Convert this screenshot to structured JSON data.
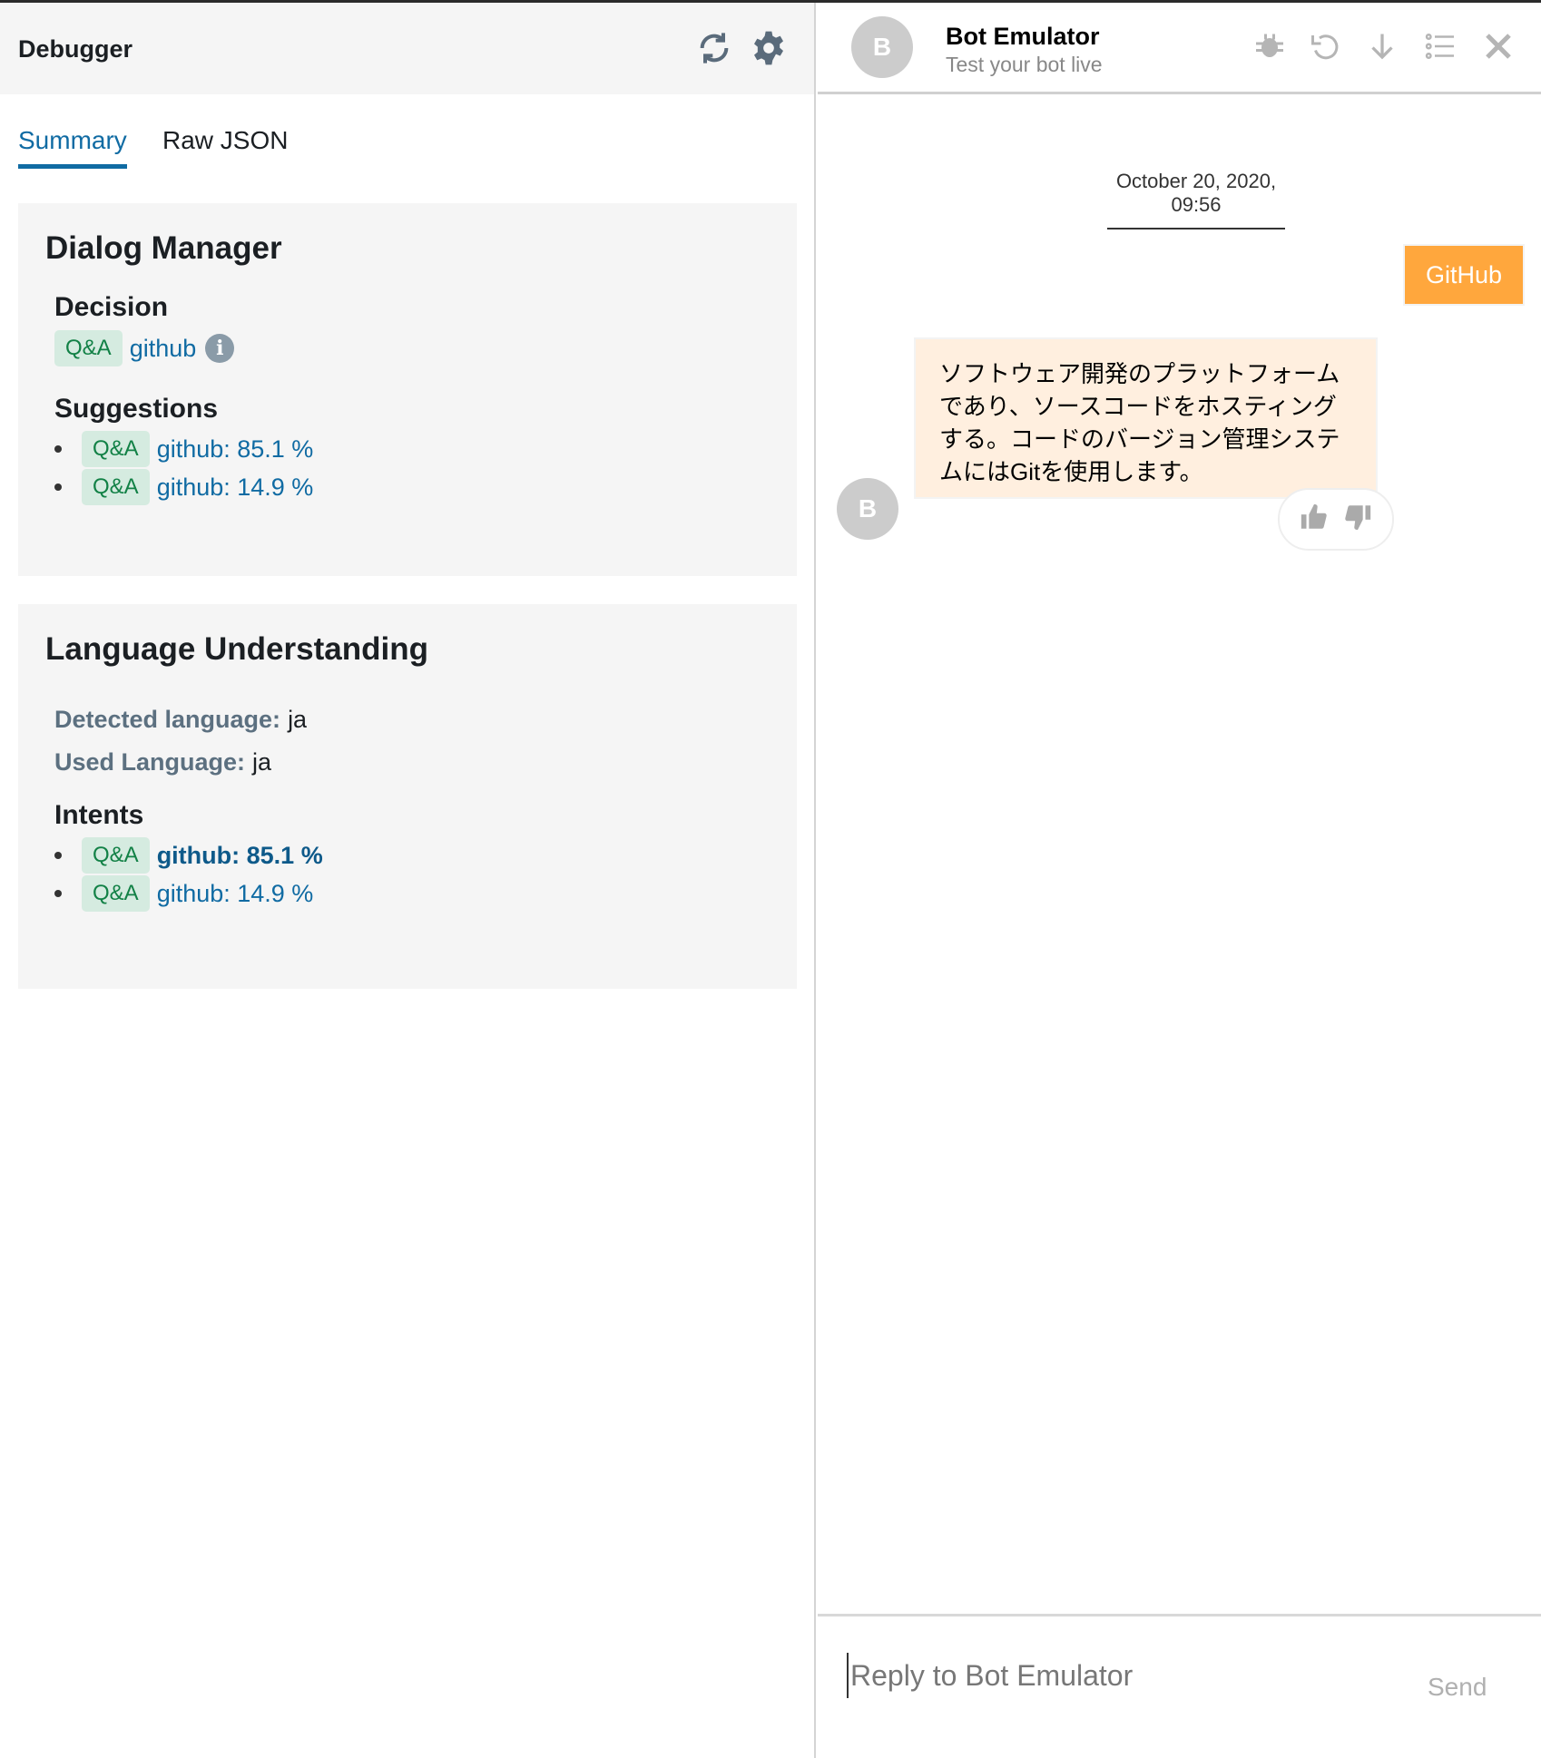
{
  "debugger": {
    "title": "Debugger",
    "icons": [
      "refresh-icon",
      "gear-icon"
    ],
    "tabs": [
      {
        "label": "Summary",
        "active": true
      },
      {
        "label": "Raw JSON",
        "active": false
      }
    ],
    "dialog_manager": {
      "title": "Dialog Manager",
      "decision_label": "Decision",
      "decision": {
        "badge": "Q&A",
        "value": "github"
      },
      "suggestions_label": "Suggestions",
      "suggestions": [
        {
          "badge": "Q&A",
          "value": "github: 85.1 %"
        },
        {
          "badge": "Q&A",
          "value": "github: 14.9 %"
        }
      ]
    },
    "language_understanding": {
      "title": "Language Understanding",
      "detected_label": "Detected language:",
      "detected_value": "ja",
      "used_label": "Used Language:",
      "used_value": "ja",
      "intents_label": "Intents",
      "intents": [
        {
          "badge": "Q&A",
          "value": "github: 85.1 %",
          "bold": true
        },
        {
          "badge": "Q&A",
          "value": "github: 14.9 %",
          "bold": false
        }
      ]
    }
  },
  "emulator": {
    "avatar_letter": "B",
    "title": "Bot Emulator",
    "subtitle": "Test your bot live",
    "icons": [
      "bug-icon",
      "undo-icon",
      "download-icon",
      "list-icon",
      "close-icon"
    ],
    "date": "October 20, 2020, 09:56",
    "user_message": "GitHub",
    "bot_message": "ソフトウェア開発のプラットフォームであり、ソースコードをホスティングする。コードのバージョン管理システムにはGitを使用します。",
    "bot_avatar_letter": "B",
    "input_placeholder": "Reply to Bot Emulator",
    "send_label": "Send"
  },
  "colors": {
    "accent": "#106ba3",
    "badge_bg": "#d5ebe0",
    "badge_text": "#128146",
    "user_bubble": "#ffa73d",
    "bot_bubble": "#ffefdf"
  }
}
